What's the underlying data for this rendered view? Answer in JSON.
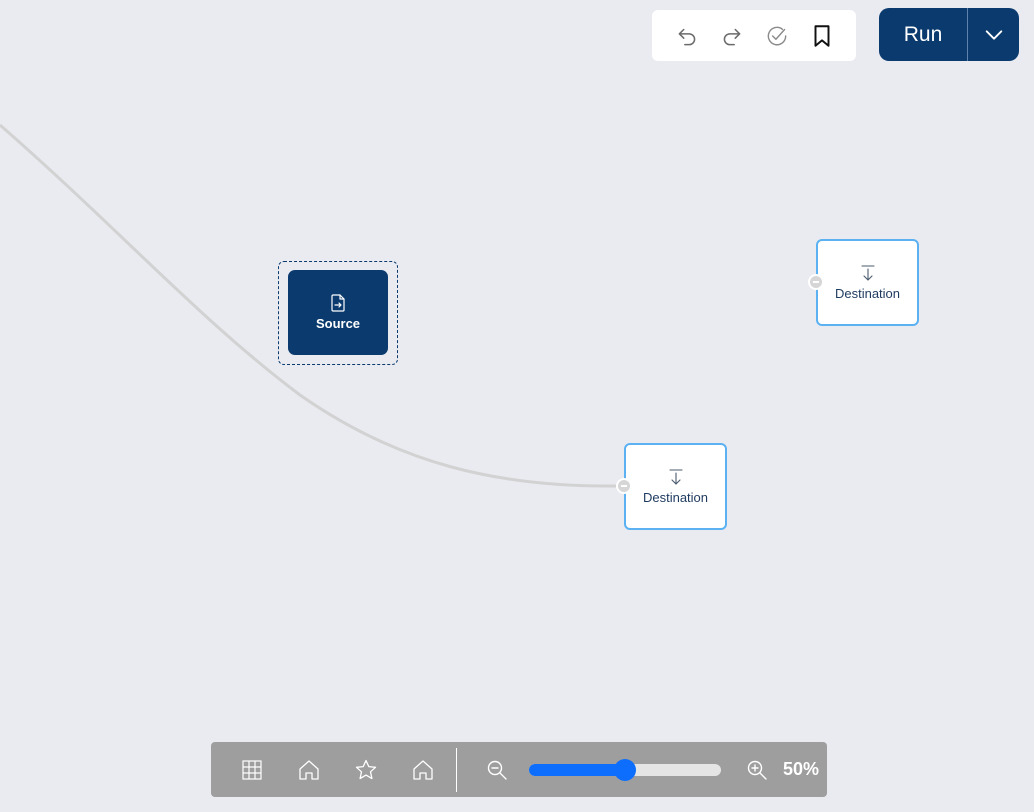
{
  "toolbar": {
    "icons": [
      "undo-icon",
      "redo-icon",
      "validate-icon",
      "bookmark-icon"
    ]
  },
  "run": {
    "label": "Run",
    "dropdown_icon": "chevron-down-icon"
  },
  "nodes": {
    "source": {
      "label": "Source",
      "icon": "file-import-icon",
      "selected": true
    },
    "destinations": [
      {
        "label": "Destination",
        "icon": "download-arrow-icon"
      },
      {
        "label": "Destination",
        "icon": "download-arrow-icon"
      }
    ]
  },
  "bottom_bar": {
    "icons": [
      "grid-icon",
      "home-icon",
      "star-icon",
      "home-icon"
    ],
    "zoom_out_icon": "zoom-out-icon",
    "zoom_in_icon": "zoom-in-icon",
    "zoom_value": 0.5,
    "zoom_label": "50%"
  },
  "colors": {
    "canvas_bg": "#e9ebf1",
    "primary": "#0a3a6e",
    "node_border": "#5bb1f2",
    "slider": "#0d6efd",
    "bottom_bar_bg": "#9e9e9e"
  }
}
